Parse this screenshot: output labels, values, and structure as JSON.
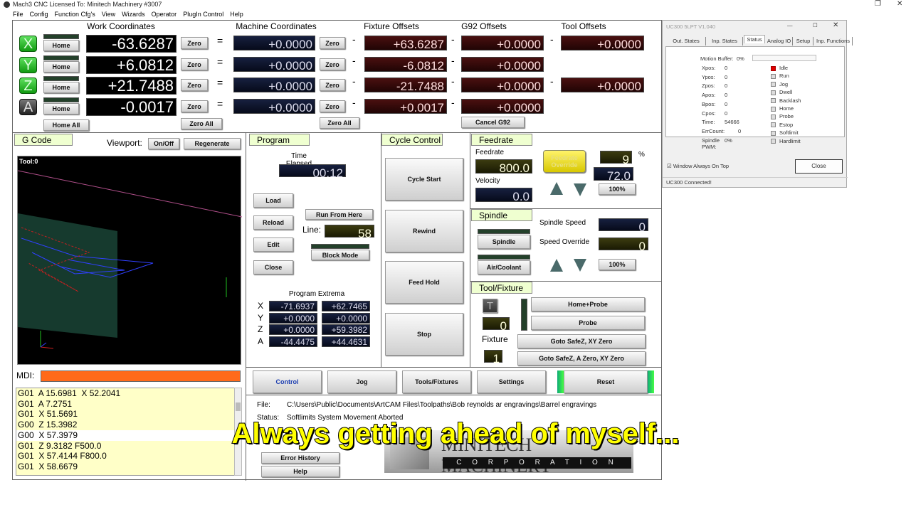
{
  "window": {
    "title": "Mach3 CNC  Licensed To: Minitech Machinery #3007",
    "restore_icon": "restore-icon",
    "close_icon": "close-icon"
  },
  "menu": [
    "File",
    "Config",
    "Function Cfg's",
    "View",
    "Wizards",
    "Operator",
    "PlugIn Control",
    "Help"
  ],
  "headers": {
    "work": "Work Coordinates",
    "machine": "Machine Coordinates",
    "fixture": "Fixture Offsets",
    "g92": "G92 Offsets",
    "tool": "Tool Offsets"
  },
  "axes": [
    {
      "name": "X",
      "work": "-63.6287",
      "machine": "+0.0000",
      "fixture": "+63.6287",
      "g92": "+0.0000",
      "tool": "+0.0000"
    },
    {
      "name": "Y",
      "work": "+6.0812",
      "machine": "+0.0000",
      "fixture": "-6.0812",
      "g92": "+0.0000",
      "tool": null
    },
    {
      "name": "Z",
      "work": "+21.7488",
      "machine": "+0.0000",
      "fixture": "-21.7488",
      "g92": "+0.0000",
      "tool": "+0.0000"
    },
    {
      "name": "A",
      "work": "-0.0017",
      "machine": "+0.0000",
      "fixture": "+0.0017",
      "g92": "+0.0000",
      "tool": null
    }
  ],
  "labels": {
    "home": "Home",
    "zero": "Zero",
    "eq": "=",
    "minus": "-",
    "home_all": "Home All",
    "zero_all": "Zero All",
    "cancel_g92": "Cancel G92"
  },
  "gcode": {
    "tab": "G Code",
    "viewport": "Viewport:",
    "onoff": "On/Off",
    "regenerate": "Regenerate",
    "tool": "Tool:0",
    "mdi": "MDI:",
    "lines": [
      "G01  A 15.6981  X 52.2041",
      "G01  A 7.2751",
      "G01  X 51.5691",
      "G00  Z 15.3982",
      "G00  X 57.3979",
      "G01  Z 9.3182 F500.0",
      "G01  X 57.4144 F800.0",
      "G01  X 58.6679"
    ],
    "current_line": 4
  },
  "program": {
    "tab": "Program",
    "time_label": "Time Elapsed",
    "time": "00:12",
    "load": "Load",
    "reload": "Reload",
    "edit": "Edit",
    "close": "Close",
    "run_from_here": "Run From Here",
    "line_label": "Line:",
    "line": "58",
    "block_mode": "Block Mode",
    "extrema_label": "Program Extrema",
    "extrema": [
      {
        "axis": "X",
        "min": "-71.6937",
        "max": "+62.7465"
      },
      {
        "axis": "Y",
        "min": "+0.0000",
        "max": "+0.0000"
      },
      {
        "axis": "Z",
        "min": "+0.0000",
        "max": "+59.3982"
      },
      {
        "axis": "A",
        "min": "-44.4475",
        "max": "+44.4631"
      }
    ]
  },
  "cycle": {
    "tab": "Cycle Control",
    "start": "Cycle Start",
    "rewind": "Rewind",
    "feed_hold": "Feed Hold",
    "stop": "Stop"
  },
  "feedrate": {
    "tab": "Feedrate",
    "feed_label": "Feedrate",
    "feed": "800.0",
    "vel_label": "Velocity",
    "vel": "0.0",
    "override_btn": "Feedrate Override",
    "override_pct": "9",
    "pct_sign": "%",
    "override_val": "72.0",
    "reset": "100%"
  },
  "spindle": {
    "tab": "Spindle",
    "spindle_btn": "Spindle",
    "coolant_btn": "Air/Coolant",
    "speed_label": "Spindle Speed",
    "speed": "0",
    "ovr_label": "Speed Override",
    "ovr": "0",
    "reset": "100%"
  },
  "toolfix": {
    "tab": "Tool/Fixture",
    "t": "T",
    "tool": "0",
    "fixture_label": "Fixture",
    "fixture": "1",
    "home_probe": "Home+Probe",
    "probe": "Probe",
    "safez_xy": "Goto SafeZ, XY Zero",
    "safez_a_xy": "Goto SafeZ, A Zero, XY Zero"
  },
  "bottom_tabs": [
    "Control",
    "Jog",
    "Tools/Fixtures",
    "Settings"
  ],
  "reset": "Reset",
  "status": {
    "file_label": "File:",
    "file": "C:\\Users\\Public\\Documents\\ArtCAM Files\\Toolpaths\\Bob reynolds ar engravings\\Barrel engravings",
    "status_label": "Status:",
    "status": "Softlimits System Movement Aborted",
    "error_history": "Error History",
    "help": "Help"
  },
  "logo": {
    "name": "MINITECH MACHINERY",
    "sub": "C O R P O R A T I O N"
  },
  "uc300": {
    "title": "UC300 5LPT V1.040",
    "tabs": [
      "Out. States",
      "Inp. States",
      "Status",
      "Analog IO",
      "Setup",
      "Inp. Functions"
    ],
    "active_tab": 2,
    "motion_label": "Motion Buffer:",
    "motion": "0%",
    "motion_fill": 0,
    "values": [
      {
        "k": "Xpos:",
        "v": "0"
      },
      {
        "k": "Ypos:",
        "v": "0"
      },
      {
        "k": "Zpos:",
        "v": "0"
      },
      {
        "k": "Apos:",
        "v": "0"
      },
      {
        "k": "Bpos:",
        "v": "0"
      },
      {
        "k": "Cpos:",
        "v": "0"
      },
      {
        "k": "Time:",
        "v": "54666"
      },
      {
        "k": "ErrCount:",
        "v": "0"
      },
      {
        "k": "Spindle PWM:",
        "v": "0%"
      }
    ],
    "states": [
      {
        "n": "Idle",
        "on": true
      },
      {
        "n": "Run",
        "on": false
      },
      {
        "n": "Jog",
        "on": false
      },
      {
        "n": "Dwell",
        "on": false
      },
      {
        "n": "Backlash",
        "on": false
      },
      {
        "n": "Home",
        "on": false
      },
      {
        "n": "Probe",
        "on": false
      },
      {
        "n": "Estop",
        "on": false
      },
      {
        "n": "Softlimit",
        "on": false
      },
      {
        "n": "Hardlimit",
        "on": false
      }
    ],
    "always_on_top": "Window Always On Top",
    "always_on_top_checked": true,
    "close": "Close",
    "connected": "UC300 Connected!"
  },
  "subtitle": "Always getting ahead of myself...",
  "colors": {
    "green_axis": "#3cc83c",
    "panel_tab": "#efffd0",
    "mdi": "#ff6a1a",
    "gcode_bg": "#ffffc8",
    "idle_led": "#e00000"
  }
}
